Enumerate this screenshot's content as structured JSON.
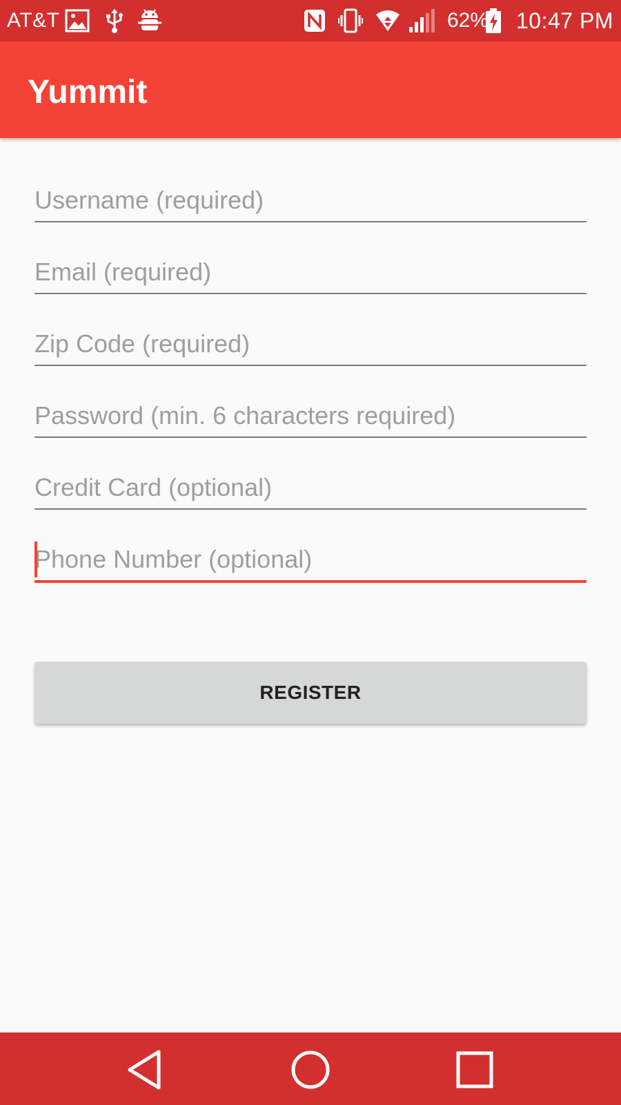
{
  "status_bar": {
    "carrier": "AT&T",
    "battery_percent": "62%",
    "time": "10:47 PM",
    "icons": [
      "image-icon",
      "usb-icon",
      "android-debug-icon",
      "nfc-icon",
      "vibrate-icon",
      "wifi-icon",
      "signal-icon",
      "battery-charging-icon"
    ]
  },
  "app_bar": {
    "title": "Yummit"
  },
  "form": {
    "username": {
      "placeholder": "Username (required)",
      "value": ""
    },
    "email": {
      "placeholder": "Email (required)",
      "value": ""
    },
    "zip_code": {
      "placeholder": "Zip Code (required)",
      "value": ""
    },
    "password": {
      "placeholder": "Password (min. 6 characters required)",
      "value": ""
    },
    "credit_card": {
      "placeholder": "Credit Card (optional)",
      "value": ""
    },
    "phone_number": {
      "placeholder": "Phone Number (optional)",
      "value": ""
    },
    "register_label": "REGISTER"
  },
  "nav_bar": {
    "buttons": [
      "back-icon",
      "home-icon",
      "recents-icon"
    ]
  },
  "colors": {
    "status_bar": "#d32f2f",
    "app_bar": "#f44336",
    "accent": "#f44336",
    "background": "#fafafa",
    "button": "#d6d7d7",
    "placeholder": "#9e9e9e"
  }
}
